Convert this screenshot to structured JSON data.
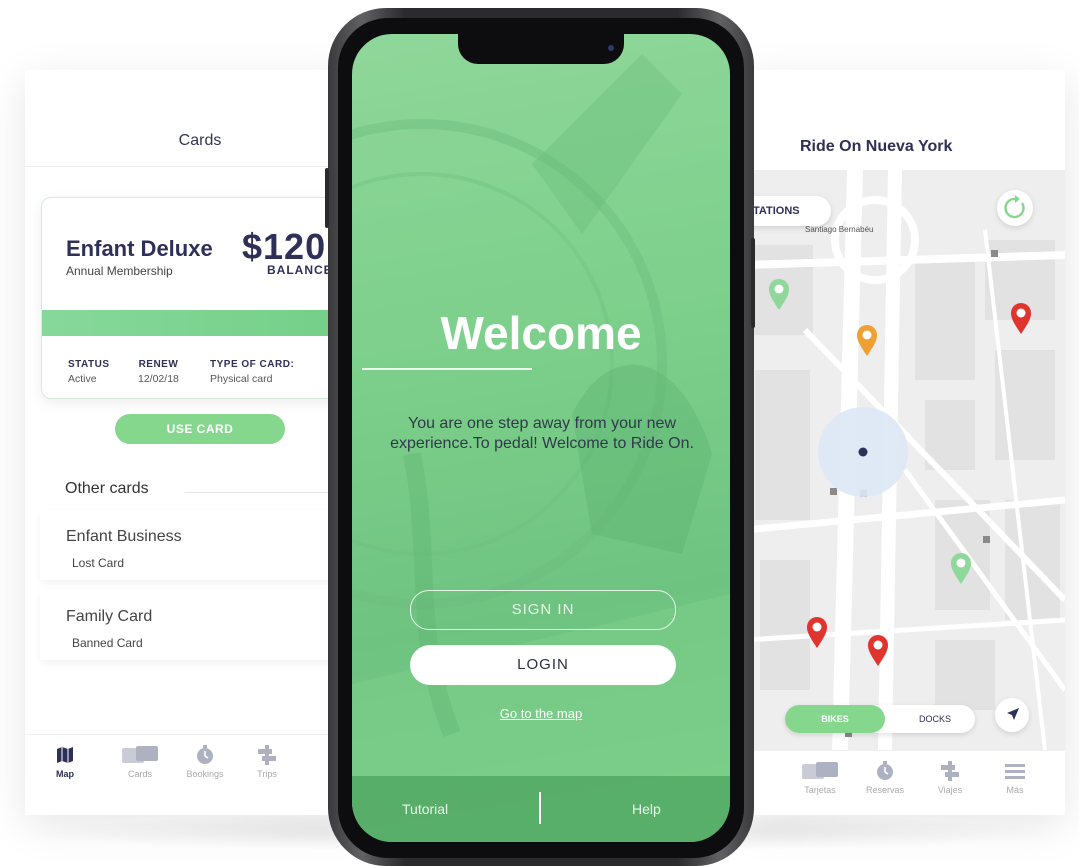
{
  "left_screen": {
    "title": "Cards",
    "card": {
      "name": "Enfant Deluxe",
      "subtitle": "Annual Membership",
      "amount": "$120",
      "balance_label": "BALANCE",
      "status_label": "STATUS",
      "status_value": "Active",
      "renew_label": "RENEW",
      "renew_value": "12/02/18",
      "type_label": "TYPE OF CARD:",
      "type_value": "Physical card"
    },
    "use_card_label": "USE CARD",
    "other_cards_title": "Other cards",
    "other_cards": [
      {
        "name": "Enfant Business",
        "status": "Lost Card"
      },
      {
        "name": "Family Card",
        "status": "Banned Card"
      }
    ],
    "tabs": [
      {
        "label": "Map",
        "icon": "map-icon"
      },
      {
        "label": "Cards",
        "icon": "cards-icon"
      },
      {
        "label": "Bookings",
        "icon": "stopwatch-icon"
      },
      {
        "label": "Trips",
        "icon": "trips-icon"
      }
    ]
  },
  "phone": {
    "welcome_title": "Welcome",
    "welcome_text": "You are one step away from your new experience.To pedal! Welcome to Ride On.",
    "sign_in_label": "SIGN IN",
    "login_label": "LOGIN",
    "go_to_map_label": "Go to the map",
    "footer_left": "Tutorial",
    "footer_right": "Help",
    "accent": "#7ccf8a"
  },
  "right_screen": {
    "title": "Ride On Nueva York",
    "stations_label": "TATIONS",
    "landmark_label": "Santiago Bernabéu",
    "toggle_on": "BIKES",
    "toggle_off": "DOCKS",
    "tabs": [
      {
        "label": "Tarjetas",
        "icon": "cards-icon"
      },
      {
        "label": "Reservas",
        "icon": "stopwatch-icon"
      },
      {
        "label": "Viajes",
        "icon": "trips-icon"
      },
      {
        "label": "Más",
        "icon": "menu-icon"
      }
    ],
    "pin_colors": {
      "green": "#8fd79a",
      "orange": "#f0a032",
      "red": "#e0342f"
    }
  }
}
